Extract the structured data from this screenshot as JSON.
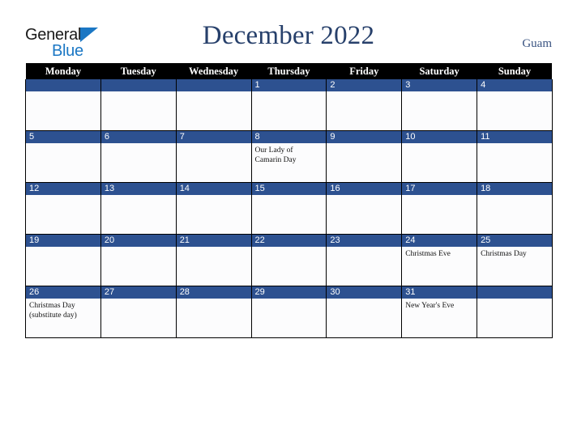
{
  "brand": {
    "line1": "General",
    "line2": "Blue",
    "triangle_icon": "brand-triangle-icon",
    "color_dark": "#1a1a1a",
    "color_blue": "#1b77c4"
  },
  "header": {
    "title": "December 2022",
    "region": "Guam",
    "title_color": "#27406b",
    "region_color": "#3b5482"
  },
  "theme": {
    "header_bar": "#000000",
    "day_bar": "#2d5190",
    "cell_bg": "#fcfcfd",
    "grid_line": "#000000"
  },
  "weekdays": [
    "Monday",
    "Tuesday",
    "Wednesday",
    "Thursday",
    "Friday",
    "Saturday",
    "Sunday"
  ],
  "weeks": [
    [
      {
        "day": "",
        "events": []
      },
      {
        "day": "",
        "events": []
      },
      {
        "day": "",
        "events": []
      },
      {
        "day": "1",
        "events": []
      },
      {
        "day": "2",
        "events": []
      },
      {
        "day": "3",
        "events": []
      },
      {
        "day": "4",
        "events": []
      }
    ],
    [
      {
        "day": "5",
        "events": []
      },
      {
        "day": "6",
        "events": []
      },
      {
        "day": "7",
        "events": []
      },
      {
        "day": "8",
        "events": [
          "Our Lady of",
          "Camarin Day"
        ]
      },
      {
        "day": "9",
        "events": []
      },
      {
        "day": "10",
        "events": []
      },
      {
        "day": "11",
        "events": []
      }
    ],
    [
      {
        "day": "12",
        "events": []
      },
      {
        "day": "13",
        "events": []
      },
      {
        "day": "14",
        "events": []
      },
      {
        "day": "15",
        "events": []
      },
      {
        "day": "16",
        "events": []
      },
      {
        "day": "17",
        "events": []
      },
      {
        "day": "18",
        "events": []
      }
    ],
    [
      {
        "day": "19",
        "events": []
      },
      {
        "day": "20",
        "events": []
      },
      {
        "day": "21",
        "events": []
      },
      {
        "day": "22",
        "events": []
      },
      {
        "day": "23",
        "events": []
      },
      {
        "day": "24",
        "events": [
          "Christmas Eve"
        ]
      },
      {
        "day": "25",
        "events": [
          "Christmas Day"
        ]
      }
    ],
    [
      {
        "day": "26",
        "events": [
          "Christmas Day",
          "(substitute day)"
        ]
      },
      {
        "day": "27",
        "events": []
      },
      {
        "day": "28",
        "events": []
      },
      {
        "day": "29",
        "events": []
      },
      {
        "day": "30",
        "events": []
      },
      {
        "day": "31",
        "events": [
          "New Year's Eve"
        ]
      },
      {
        "day": "",
        "events": []
      }
    ]
  ]
}
